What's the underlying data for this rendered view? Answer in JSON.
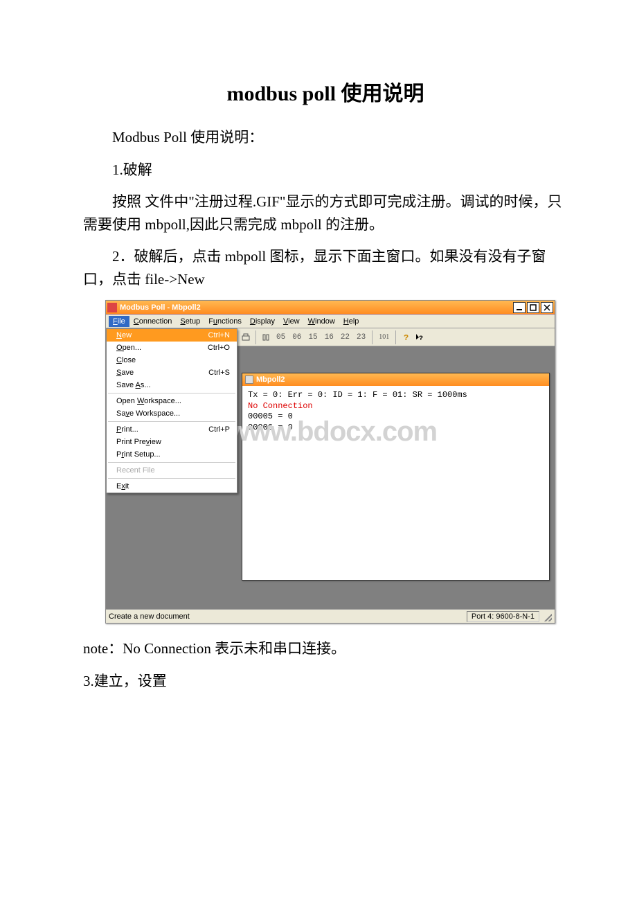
{
  "doc": {
    "title": "modbus poll 使用说明",
    "p1": "Modbus Poll 使用说明：",
    "p2": "1.破解",
    "p3": "按照 文件中\"注册过程.GIF\"显示的方式即可完成注册。调试的时候，只需要使用 mbpoll,因此只需完成 mbpoll 的注册。",
    "p4": "2．破解后，点击 mbpoll 图标，显示下面主窗口。如果没有没有子窗口，点击 file->New",
    "note": " note：No Connection 表示未和串口连接。",
    "p5": "3.建立，设置"
  },
  "win": {
    "title": "Modbus Poll - Mbpoll2",
    "menu": {
      "file": "File",
      "connection": "Connection",
      "setup": "Setup",
      "functions": "Functions",
      "display": "Display",
      "view": "View",
      "window": "Window",
      "help": "Help"
    },
    "dropdown": [
      {
        "label": "New",
        "accel": "Ctrl+N",
        "sel": true,
        "ulpos": 0
      },
      {
        "label": "Open...",
        "accel": "Ctrl+O",
        "ulpos": 0
      },
      {
        "label": "Close",
        "accel": "",
        "ulpos": 0
      },
      {
        "label": "Save",
        "accel": "Ctrl+S",
        "ulpos": 0
      },
      {
        "label": "Save As...",
        "accel": "",
        "ulpos": 5
      },
      {
        "sep": true
      },
      {
        "label": "Open Workspace...",
        "accel": "",
        "ulpos": 5
      },
      {
        "label": "Save Workspace...",
        "accel": "",
        "ulpos": 2
      },
      {
        "sep": true
      },
      {
        "label": "Print...",
        "accel": "Ctrl+P",
        "ulpos": 0
      },
      {
        "label": "Print Preview",
        "accel": "",
        "ulpos": 9
      },
      {
        "label": "Print Setup...",
        "accel": "",
        "ulpos": 1
      },
      {
        "sep": true
      },
      {
        "label": "Recent File",
        "accel": "",
        "disabled": true
      },
      {
        "sep": true
      },
      {
        "label": "Exit",
        "accel": "",
        "ulpos": 1
      }
    ],
    "toolbar": {
      "codes": [
        "05",
        "06",
        "15",
        "16",
        "22",
        "23"
      ],
      "tag": "101"
    },
    "child": {
      "title": "Mbpoll2",
      "status": "Tx = 0: Err = 0: ID = 1: F = 01: SR = 1000ms",
      "noconn": "No Connection",
      "l1": "00005 = 0",
      "l2": "00006 = 0"
    },
    "statusbar": {
      "left": "Create a new document",
      "right": "Port 4: 9600-8-N-1"
    },
    "watermark": "www.bdocx.com"
  }
}
